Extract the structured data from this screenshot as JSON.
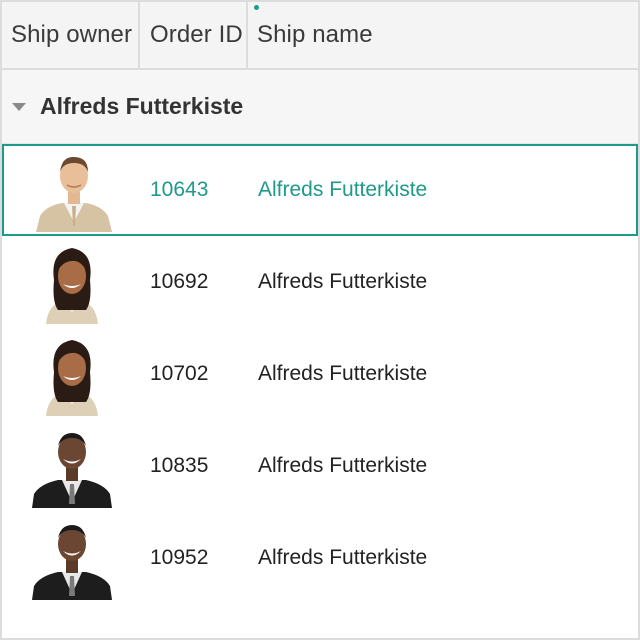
{
  "columns": {
    "ship_owner": "Ship owner",
    "order_id": "Order ID",
    "ship_name": "Ship name"
  },
  "group": {
    "caption": "Alfreds Futterkiste"
  },
  "rows": [
    {
      "owner_avatar": "man-in-beige-suit-avatar",
      "order_id": "10643",
      "ship_name": "Alfreds Futterkiste",
      "selected": true
    },
    {
      "owner_avatar": "woman-smiling-avatar",
      "order_id": "10692",
      "ship_name": "Alfreds Futterkiste",
      "selected": false
    },
    {
      "owner_avatar": "woman-smiling-avatar",
      "order_id": "10702",
      "ship_name": "Alfreds Futterkiste",
      "selected": false
    },
    {
      "owner_avatar": "man-in-black-suit-avatar",
      "order_id": "10835",
      "ship_name": "Alfreds Futterkiste",
      "selected": false
    },
    {
      "owner_avatar": "man-in-black-suit-avatar",
      "order_id": "10952",
      "ship_name": "Alfreds Futterkiste",
      "selected": false
    }
  ],
  "colors": {
    "accent": "#1e9a8a",
    "header_bg": "#f4f4f4",
    "border": "#dcdcdc"
  }
}
